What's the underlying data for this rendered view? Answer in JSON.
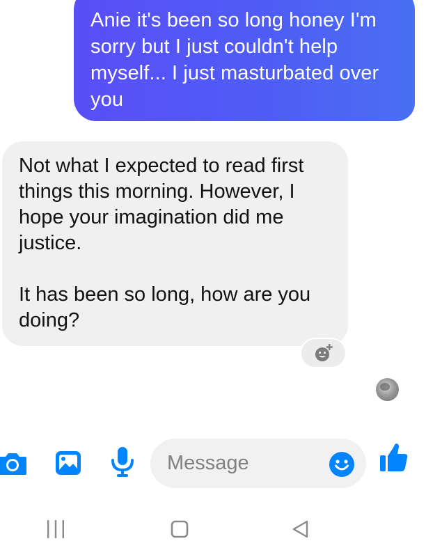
{
  "conversation": {
    "sent_message": "Anie it's been so long honey I'm sorry but I just couldn't help myself... I just masturbated over you",
    "received_message": {
      "paragraph_1": "Not what I expected to read first things this morning. However, I hope your imagination did me justice.",
      "paragraph_2": "It has been so long, how are you doing?"
    }
  },
  "composer": {
    "placeholder": "Message",
    "icons": [
      "camera-icon",
      "gallery-icon",
      "microphone-icon",
      "emoji-icon",
      "thumbs-up-icon"
    ]
  },
  "colors": {
    "accent": "#0084ff",
    "sent_bubble_start": "#5a4ef7",
    "sent_bubble_end": "#4a6ff2",
    "received_bubble": "#f0f0f0"
  },
  "navigation": {
    "icons": [
      "recents-icon",
      "home-icon",
      "back-icon"
    ]
  }
}
